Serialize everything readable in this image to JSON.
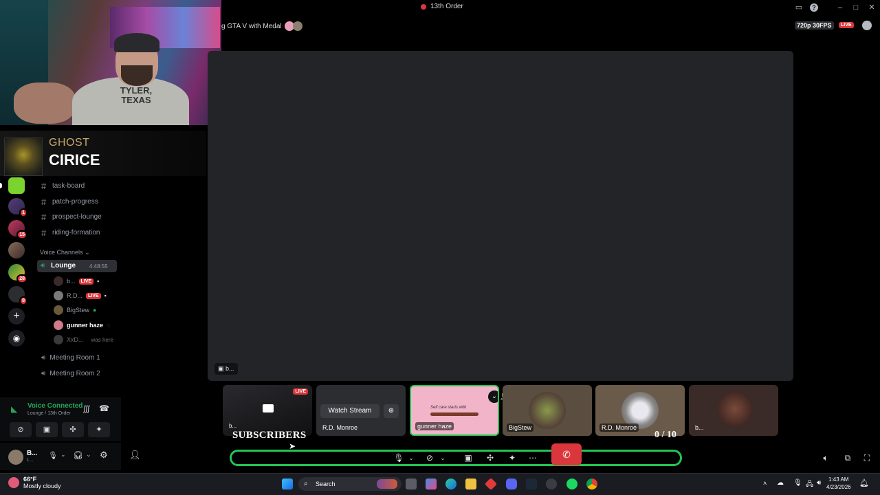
{
  "window": {
    "title": "13th Order"
  },
  "stream": {
    "title": "g GTA V with Medal",
    "quality": "720p 30FPS",
    "live_label": "LIVE",
    "stage_label": "b..."
  },
  "now_playing": {
    "artist": "GHOST",
    "song": "CIRICE"
  },
  "webcam": {
    "shirt_text": "TYLER, TEXAS"
  },
  "servers": [
    {
      "badge": "1"
    },
    {
      "badge": "15"
    },
    {
      "badge": ""
    },
    {
      "badge": "28"
    },
    {
      "badge": "8"
    }
  ],
  "channels": {
    "partial_top": "...",
    "text": [
      {
        "name": "task-board"
      },
      {
        "name": "patch-progress"
      },
      {
        "name": "prospect-lounge"
      },
      {
        "name": "riding-formation"
      }
    ],
    "voice_header": "Voice Channels",
    "lounge": {
      "name": "Lounge",
      "timer": "4:48:55"
    },
    "users": [
      {
        "name": "b...",
        "live": "LIVE"
      },
      {
        "name": "R.D...",
        "live": "LIVE"
      },
      {
        "name": "BigStew",
        "live": ""
      },
      {
        "name": "gunner haze",
        "live": ""
      },
      {
        "name": "XxD...",
        "note": "was here"
      }
    ],
    "meeting_rooms": [
      {
        "name": "Meeting Room 1"
      },
      {
        "name": "Meeting Room 2"
      }
    ]
  },
  "voice_panel": {
    "status": "Voice Connected",
    "location": "Lounge / 13th Order"
  },
  "user_panel": {
    "name": "B...",
    "sub": "L..."
  },
  "tiles": [
    {
      "name": "b...",
      "live": "LIVE"
    },
    {
      "name": "R.D. Monroe",
      "watch": "Watch Stream"
    },
    {
      "name": "gunner haze",
      "art_text": "Self care starts with"
    },
    {
      "name": "BigStew"
    },
    {
      "name": "R.D. Monroe"
    },
    {
      "name": "b..."
    }
  ],
  "overlay": {
    "subscribers": "SUBSCRIBERS",
    "sub_count": "0 / 10"
  },
  "taskbar": {
    "temp": "66°F",
    "condition": "Mostly cloudy",
    "search_placeholder": "Search",
    "time": "1:43 AM",
    "date": "4/23/2026"
  },
  "colors": {
    "accent_green": "#23c552",
    "live_red": "#da373c",
    "discord_bg": "#000000"
  }
}
